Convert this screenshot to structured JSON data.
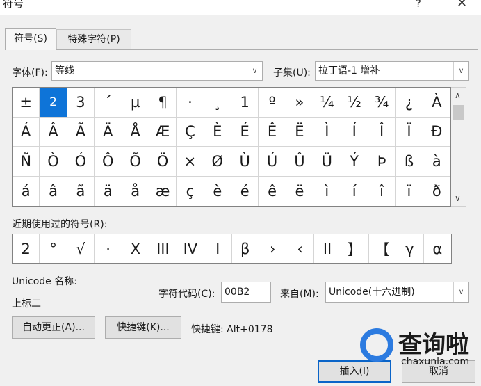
{
  "dialog": {
    "title": "符号",
    "help": "?",
    "close": "✕"
  },
  "tabs": [
    {
      "label": "符号(S)"
    },
    {
      "label": "特殊字符(P)"
    }
  ],
  "font": {
    "label": "字体(F):",
    "value": "等线"
  },
  "subset": {
    "label": "子集(U):",
    "value": "拉丁语-1 增补"
  },
  "symbols": [
    "±",
    "2",
    "3",
    "´",
    "µ",
    "¶",
    "·",
    "¸",
    "1",
    "º",
    "»",
    "¼",
    "½",
    "¾",
    "¿",
    "À",
    "Á",
    "Â",
    "Ã",
    "Ä",
    "Å",
    "Æ",
    "Ç",
    "È",
    "É",
    "Ê",
    "Ë",
    "Ì",
    "Í",
    "Î",
    "Ï",
    "Ð",
    "Ñ",
    "Ò",
    "Ó",
    "Ô",
    "Õ",
    "Ö",
    "×",
    "Ø",
    "Ù",
    "Ú",
    "Û",
    "Ü",
    "Ý",
    "Þ",
    "ß",
    "à",
    "á",
    "â",
    "ã",
    "ä",
    "å",
    "æ",
    "ç",
    "è",
    "é",
    "ê",
    "ë",
    "ì",
    "í",
    "î",
    "ï",
    "ð"
  ],
  "selected_index": 1,
  "recent": {
    "label": "近期使用过的符号(R):",
    "items": [
      "2",
      "°",
      "√",
      "·",
      "X",
      "III",
      "IV",
      "I",
      "β",
      "›",
      "‹",
      "II",
      "】",
      "【",
      "γ",
      "α"
    ]
  },
  "unicode_name": {
    "label": "Unicode 名称:",
    "value": "上标二"
  },
  "char_code": {
    "label": "字符代码(C):",
    "value": "00B2"
  },
  "from": {
    "label": "来自(M):",
    "value": "Unicode(十六进制)"
  },
  "buttons": {
    "autocorrect": "自动更正(A)...",
    "shortcut_key": "快捷键(K)...",
    "insert": "插入(I)",
    "cancel": "取消"
  },
  "shortcut_text": "快捷键: Alt+0178",
  "watermark": {
    "brand": "查询啦",
    "domain": "chaxunla.com"
  }
}
